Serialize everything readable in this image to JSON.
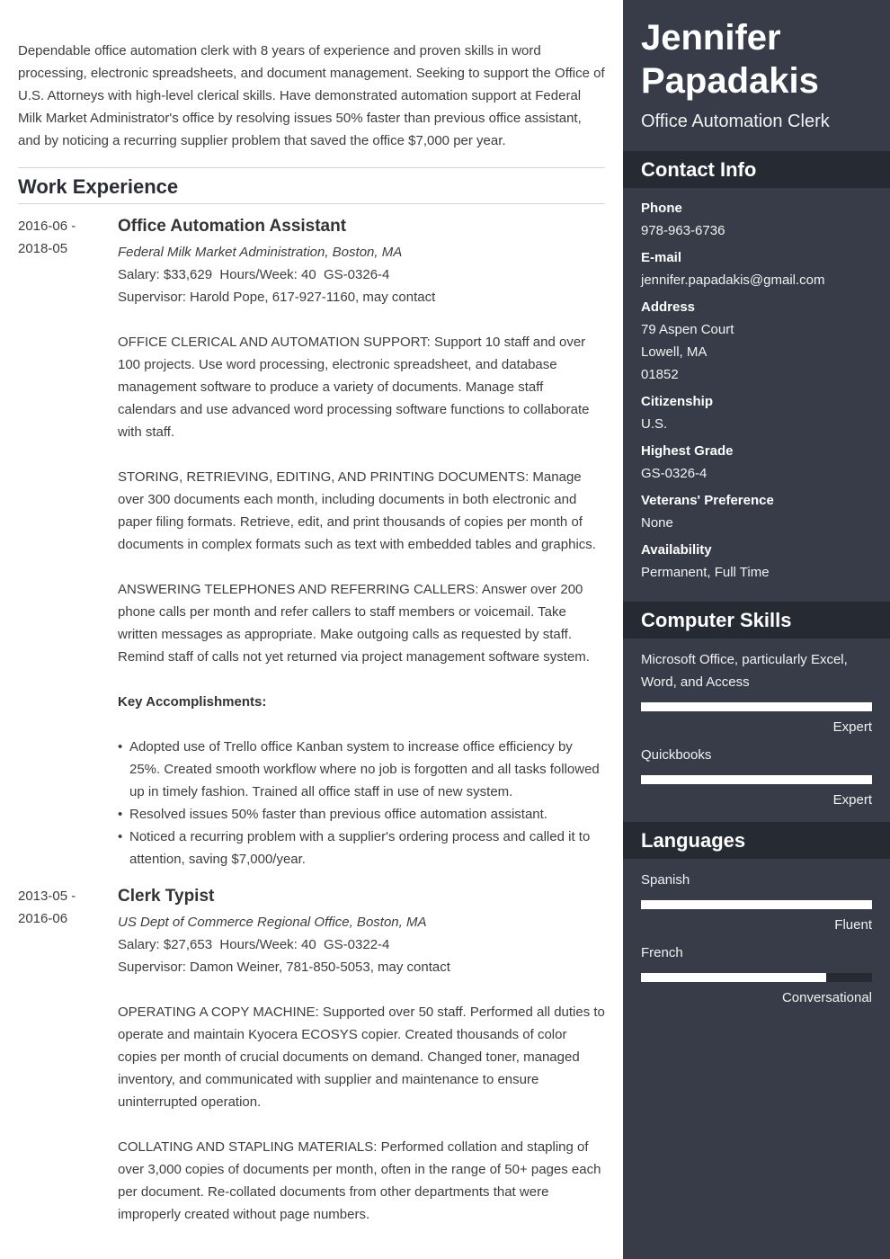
{
  "summary": "Dependable office automation clerk with 8 years of experience and proven skills in word processing, electronic spreadsheets, and document management. Seeking to support the Office of U.S. Attorneys with high-level clerical skills. Have demonstrated automation support at Federal Milk Market Administrator's office by resolving issues 50% faster than previous office assistant, and by noticing a recurring supplier problem that saved the office $7,000 per year.",
  "work_heading": "Work Experience",
  "jobs": [
    {
      "dates_start": "2016-06 -",
      "dates_end": "2018-05",
      "title": "Office Automation Assistant",
      "employer": "Federal Milk Market Administration, Boston, MA",
      "salary_line": "Salary: $33,629  Hours/Week: 40  GS-0326-4",
      "supervisor": "Supervisor: Harold Pope, 617-927-1160, may contact",
      "paragraphs": [
        "OFFICE CLERICAL AND AUTOMATION SUPPORT: Support 10 staff and over 100 projects. Use word processing, electronic spreadsheet, and database management software to produce a variety of documents. Manage staff calendars and use advanced word processing software functions to collaborate with staff.",
        "STORING, RETRIEVING, EDITING, AND PRINTING DOCUMENTS: Manage over 300 documents each month, including documents in both electronic and paper filing formats. Retrieve, edit, and print thousands of copies per month of documents in complex formats such as text with embedded tables and graphics.",
        "ANSWERING TELEPHONES AND REFERRING CALLERS: Answer over 200 phone calls per month and refer callers to staff members or voicemail. Take written messages as appropriate. Make outgoing calls as requested by staff. Remind staff of calls not yet returned via project management software system."
      ],
      "accomplishments_label": "Key Accomplishments:",
      "accomplishments": [
        "Adopted use of Trello office Kanban system to increase office efficiency by 25%. Created smooth workflow where no job is forgotten and all tasks followed up in timely fashion. Trained all office staff in use of new system.",
        "Resolved issues 50% faster than previous office automation assistant.",
        "Noticed a recurring problem with a supplier's ordering process and called it to attention, saving $7,000/year."
      ]
    },
    {
      "dates_start": "2013-05 -",
      "dates_end": "2016-06",
      "title": "Clerk Typist",
      "employer": "US Dept of Commerce Regional Office, Boston, MA",
      "salary_line": "Salary: $27,653  Hours/Week: 40  GS-0322-4",
      "supervisor": "Supervisor: Damon Weiner, 781-850-5053, may contact",
      "paragraphs": [
        "OPERATING A COPY MACHINE: Supported over 50 staff. Performed all duties to operate and maintain Kyocera ECOSYS copier. Created thousands of color copies per month of crucial documents on demand. Changed toner, managed inventory, and communicated with supplier and maintenance to ensure uninterrupted operation.",
        "COLLATING AND STAPLING MATERIALS: Performed collation and stapling of over 3,000 copies of documents per month, often in the range of 50+ pages each per document. Re-collated documents from other departments that were improperly created without page numbers."
      ]
    }
  ],
  "sidebar": {
    "first_name": "Jennifer",
    "last_name": "Papadakis",
    "role": "Office Automation Clerk",
    "contact_heading": "Contact Info",
    "contact": {
      "phone_label": "Phone",
      "phone": "978-963-6736",
      "email_label": "E-mail",
      "email": "jennifer.papadakis@gmail.com",
      "address_label": "Address",
      "address_line1": "79 Aspen Court",
      "address_line2": "Lowell, MA",
      "address_line3": "01852",
      "citizenship_label": "Citizenship",
      "citizenship": "U.S.",
      "grade_label": "Highest Grade",
      "grade": "GS-0326-4",
      "veterans_label": "Veterans' Preference",
      "veterans": "None",
      "availability_label": "Availability",
      "availability": "Permanent, Full Time"
    },
    "skills_heading": "Computer Skills",
    "skills": [
      {
        "name": "Microsoft Office, particularly Excel, Word, and Access",
        "level": "Expert",
        "fill_percent": 100
      },
      {
        "name": "Quickbooks",
        "level": "Expert",
        "fill_percent": 100
      }
    ],
    "languages_heading": "Languages",
    "languages": [
      {
        "name": "Spanish",
        "level": "Fluent",
        "fill_percent": 100
      },
      {
        "name": "French",
        "level": "Conversational",
        "fill_percent": 80
      }
    ]
  },
  "colors": {
    "sidebar_bg": "#373c48",
    "sidebar_header_bg": "#262a33",
    "bar_fill": "#ffffff",
    "heading_text": "#2a2d36"
  }
}
